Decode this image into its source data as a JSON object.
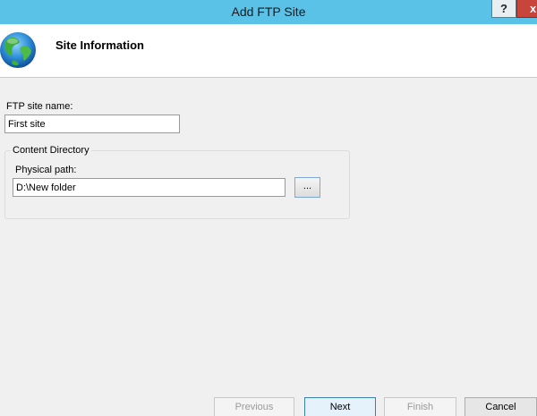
{
  "window": {
    "title": "Add FTP Site",
    "help_label": "?",
    "close_label": "x"
  },
  "header": {
    "title": "Site Information",
    "icon": "globe-icon"
  },
  "form": {
    "site_name_label": "FTP site name:",
    "site_name_value": "First site",
    "content_directory": {
      "legend": "Content Directory",
      "physical_path_label": "Physical path:",
      "physical_path_value": "D:\\New folder",
      "browse_label": "..."
    }
  },
  "buttons": {
    "previous": "Previous",
    "next": "Next",
    "finish": "Finish",
    "cancel": "Cancel"
  },
  "colors": {
    "titlebar": "#5bc2e7",
    "close_button": "#c7453a",
    "default_button_border": "#3c7fb1"
  }
}
